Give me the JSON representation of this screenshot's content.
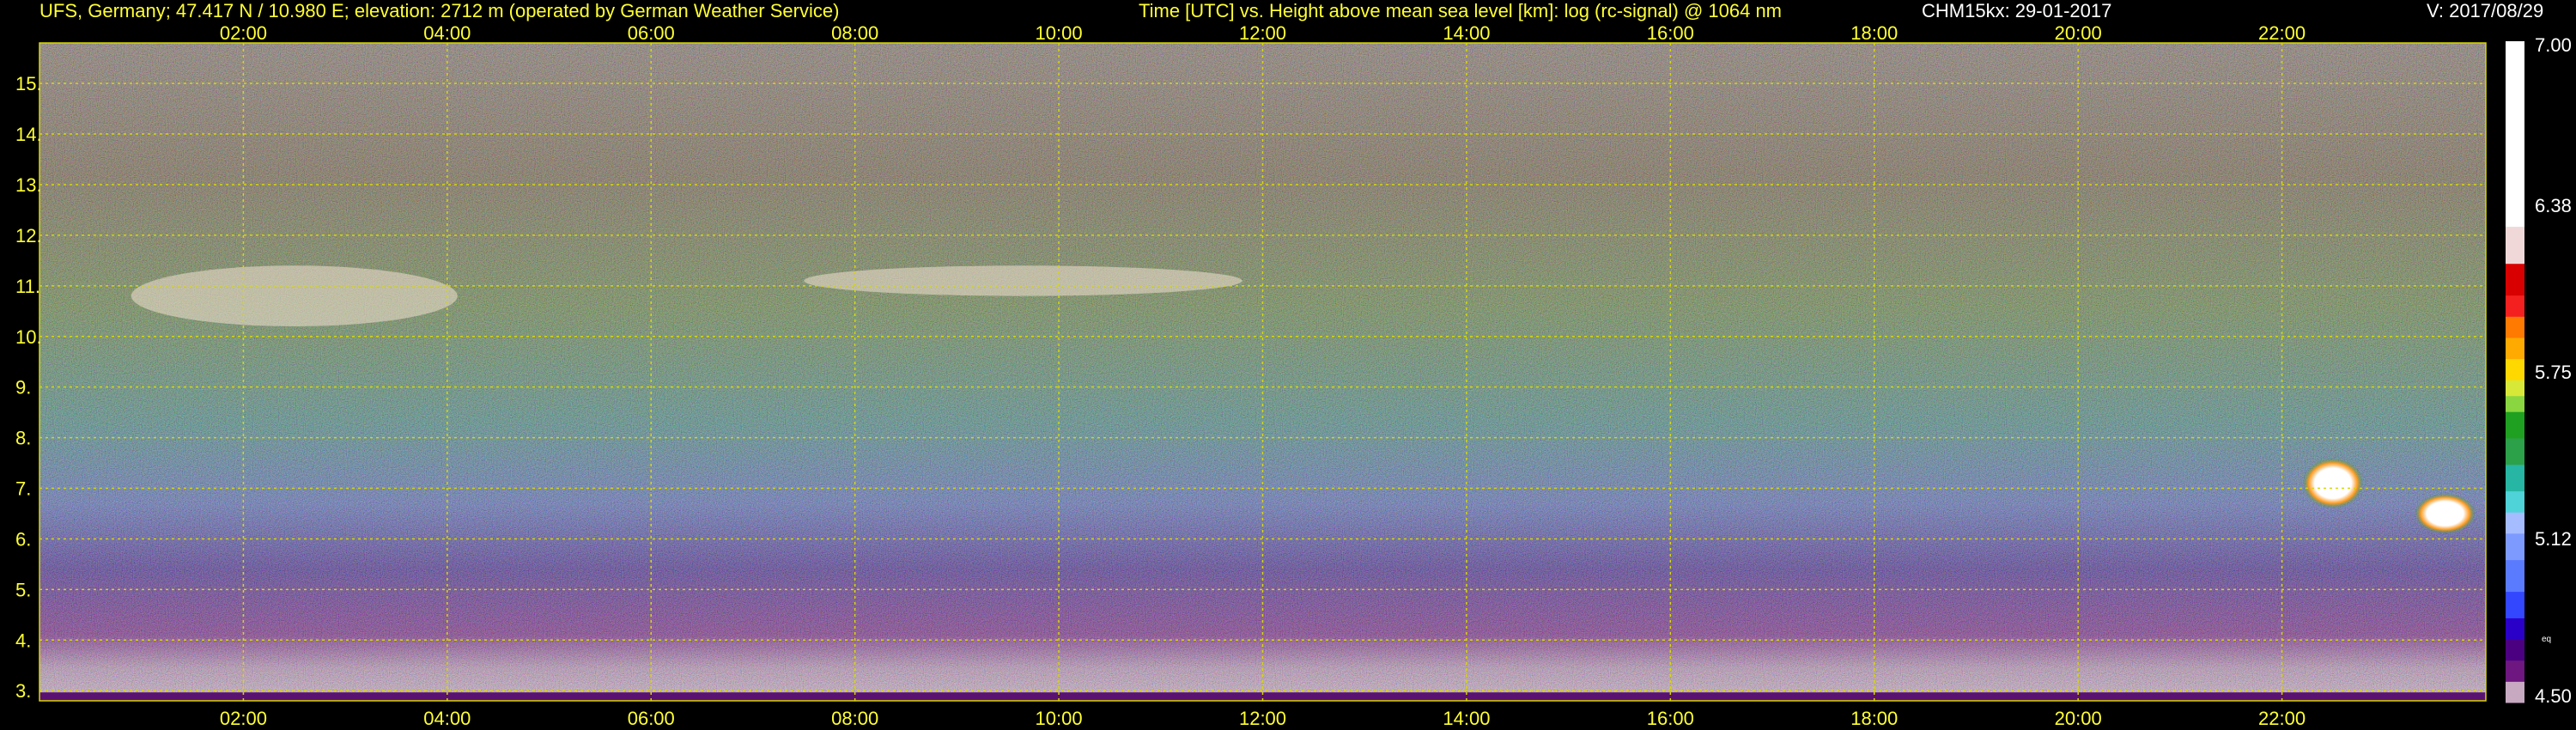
{
  "header": {
    "station": "UFS, Germany; 47.417 N / 10.980 E; elevation: 2712 m  (operated by German Weather Service)",
    "axes_desc": "Time [UTC] vs. Height above mean sea level [km]: log (rc-signal) @ 1064 nm",
    "instrument": "CHM15kx: 29-01-2017",
    "version": "V: 2017/08/29"
  },
  "colors": {
    "background": "#000000",
    "label_yellow": "#ffff33",
    "grid": "#d8d800",
    "text_white": "#ffffff"
  },
  "chart_data": {
    "type": "heatmap",
    "title": "Time [UTC] vs. Height above mean sea level [km]: log (rc-signal) @ 1064 nm",
    "xlabel": "Time [UTC]",
    "ylabel": "Height above mean sea level [km]",
    "x_range_hours": [
      0,
      24
    ],
    "ylim_km": [
      2.8,
      15.8
    ],
    "x_ticks": [
      "02:00",
      "04:00",
      "06:00",
      "08:00",
      "10:00",
      "12:00",
      "14:00",
      "16:00",
      "18:00",
      "20:00",
      "22:00"
    ],
    "x_tick_hours": [
      2,
      4,
      6,
      8,
      10,
      12,
      14,
      16,
      18,
      20,
      22
    ],
    "y_ticks": [
      "3.",
      "4.",
      "5.",
      "6.",
      "7.",
      "8.",
      "9.",
      "10.",
      "11.",
      "12.",
      "13.",
      "14.",
      "15."
    ],
    "y_tick_values": [
      3,
      4,
      5,
      6,
      7,
      8,
      9,
      10,
      11,
      12,
      13,
      14,
      15
    ],
    "grid": true,
    "colorbar": {
      "min": 4.5,
      "max": 7.0,
      "labels": [
        "7.00",
        "6.38",
        "5.75",
        "5.12",
        "4.50"
      ],
      "label_values": [
        7.0,
        6.38,
        5.75,
        5.12,
        4.5
      ],
      "small_label": "eq",
      "stops": [
        [
          4.5,
          "#c7a9c2"
        ],
        [
          4.58,
          "#6e1780"
        ],
        [
          4.66,
          "#4b0082"
        ],
        [
          4.74,
          "#2a00c8"
        ],
        [
          4.82,
          "#3347ff"
        ],
        [
          4.92,
          "#5b7bff"
        ],
        [
          5.04,
          "#7d9bff"
        ],
        [
          5.14,
          "#a5bcff"
        ],
        [
          5.22,
          "#4fd2d8"
        ],
        [
          5.3,
          "#27b6a3"
        ],
        [
          5.4,
          "#2da04a"
        ],
        [
          5.5,
          "#20a020"
        ],
        [
          5.6,
          "#8ad640"
        ],
        [
          5.66,
          "#d8e838"
        ],
        [
          5.72,
          "#ffd800"
        ],
        [
          5.8,
          "#ffaa00"
        ],
        [
          5.88,
          "#ff7a00"
        ],
        [
          5.96,
          "#f42020"
        ],
        [
          6.04,
          "#d80000"
        ],
        [
          6.16,
          "#f0d8d8"
        ],
        [
          6.3,
          "#ffffff"
        ],
        [
          7.0,
          "#ffffff"
        ]
      ]
    },
    "features": [
      {
        "kind": "cirrus",
        "t_start": 0.9,
        "t_end": 4.1,
        "h_bottom": 10.2,
        "h_top": 11.4,
        "level": 6.3
      },
      {
        "kind": "cirrus",
        "t_start": 7.5,
        "t_end": 11.8,
        "h_bottom": 10.8,
        "h_top": 11.4,
        "level": 6.4
      },
      {
        "kind": "cloud",
        "t_start": 22.2,
        "t_end": 22.8,
        "h_bottom": 6.6,
        "h_top": 7.6,
        "level": 7.0
      },
      {
        "kind": "cloud",
        "t_start": 23.3,
        "t_end": 23.9,
        "h_bottom": 6.1,
        "h_top": 6.9,
        "level": 6.8
      }
    ]
  }
}
